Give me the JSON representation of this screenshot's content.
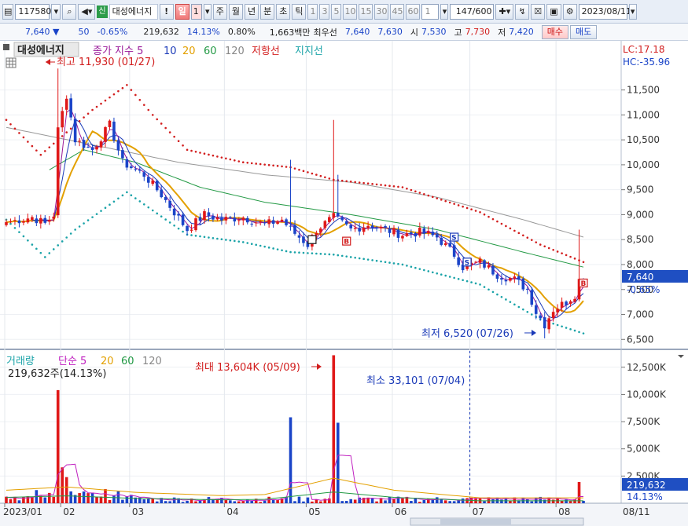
{
  "toolbar": {
    "code": "117580",
    "stock_name": "대성에너지",
    "badge": "신",
    "alert": "!",
    "period_selected": "일",
    "period_value": "1",
    "periods": [
      "주",
      "월",
      "년",
      "분",
      "초",
      "틱"
    ],
    "intervals": [
      "1",
      "3",
      "5",
      "10",
      "15",
      "30",
      "45",
      "60"
    ],
    "interval_value": "1",
    "count": "147",
    "total": "/600",
    "date": "2023/08/11"
  },
  "quote": {
    "price": "7,640",
    "change_arrow": "▼",
    "change": "50",
    "change_pct": "-0.65%",
    "volume": "219,632",
    "volume_ratio": "14.13%",
    "turnover": "0.80%",
    "amount": "1,663백만",
    "best_label": "최우선",
    "best_ask": "7,640",
    "best_bid": "7,630",
    "open_label": "시",
    "open": "7,530",
    "high_label": "고",
    "high": "7,730",
    "low_label": "저",
    "low": "7,420",
    "buy_label": "매수",
    "sell_label": "매도"
  },
  "price_panel": {
    "title": "대성에너지",
    "legend": [
      {
        "label": "종가 지수 5",
        "color": "#9a1a9a"
      },
      {
        "label": "10",
        "color": "#1a3ab8"
      },
      {
        "label": "20",
        "color": "#e3a000"
      },
      {
        "label": "60",
        "color": "#229944"
      },
      {
        "label": "120",
        "color": "#888888"
      },
      {
        "label": "저항선",
        "color": "#d21e1e"
      },
      {
        "label": "지지선",
        "color": "#1aa3a8"
      }
    ],
    "lc": "LC:17.18",
    "hc": "HC:-35.96",
    "max_annotation": "최고 11,930 (01/27)",
    "min_annotation": "최저 6,520 (07/26)",
    "price_tag": "7,640",
    "price_tag_pct": "-0.65%",
    "y_ticks": [
      "11,500",
      "11,000",
      "10,500",
      "10,000",
      "9,500",
      "9,000",
      "8,500",
      "8,000",
      "7,500",
      "7,000",
      "6,500"
    ]
  },
  "volume_panel": {
    "legend": [
      {
        "label": "거래량",
        "color": "#1aa3a8"
      },
      {
        "label": "단순 5",
        "color": "#c020c0"
      },
      {
        "label": "20",
        "color": "#e3a000"
      },
      {
        "label": "60",
        "color": "#229944"
      },
      {
        "label": "120",
        "color": "#888888"
      }
    ],
    "summary": "219,632주(14.13%)",
    "max_annotation": "최대 13,604K (05/09)",
    "min_annotation": "최소 33,101 (07/04)",
    "volume_tag": "219,632",
    "volume_tag_pct": "14.13%",
    "y_ticks": [
      "12,500K",
      "10,000K",
      "7,500K",
      "5,000K",
      "2,500K"
    ]
  },
  "x_axis": {
    "labels": [
      "2023/01",
      "02",
      "03",
      "04",
      "05",
      "06",
      "07",
      "08"
    ],
    "end_label": "08/11"
  },
  "chart_data": {
    "type": "candlestick",
    "price_range": [
      6300,
      11950
    ],
    "volume_range": [
      0,
      14000000
    ],
    "anchors": [
      {
        "i": 0,
        "c": 8850
      },
      {
        "i": 6,
        "c": 8950
      },
      {
        "i": 9,
        "c": 8820
      },
      {
        "i": 11,
        "c": 9000
      },
      {
        "i": 12,
        "c": 10700
      },
      {
        "i": 14,
        "c": 11400
      },
      {
        "i": 16,
        "c": 10500
      },
      {
        "i": 20,
        "c": 10300
      },
      {
        "i": 24,
        "c": 10800
      },
      {
        "i": 27,
        "c": 10050
      },
      {
        "i": 32,
        "c": 9800
      },
      {
        "i": 36,
        "c": 9400
      },
      {
        "i": 42,
        "c": 8700
      },
      {
        "i": 46,
        "c": 9000
      },
      {
        "i": 50,
        "c": 8900
      },
      {
        "i": 55,
        "c": 8950
      },
      {
        "i": 60,
        "c": 8800
      },
      {
        "i": 64,
        "c": 8900
      },
      {
        "i": 66,
        "c": 8700
      },
      {
        "i": 70,
        "c": 8400
      },
      {
        "i": 72,
        "c": 8700
      },
      {
        "i": 76,
        "c": 8950
      },
      {
        "i": 80,
        "c": 8700
      },
      {
        "i": 84,
        "c": 8800
      },
      {
        "i": 88,
        "c": 8700
      },
      {
        "i": 92,
        "c": 8600
      },
      {
        "i": 96,
        "c": 8650
      },
      {
        "i": 100,
        "c": 8550
      },
      {
        "i": 104,
        "c": 8200
      },
      {
        "i": 106,
        "c": 7950
      },
      {
        "i": 110,
        "c": 8050
      },
      {
        "i": 114,
        "c": 7800
      },
      {
        "i": 118,
        "c": 7700
      },
      {
        "i": 121,
        "c": 7500
      },
      {
        "i": 123,
        "c": 7050
      },
      {
        "i": 125,
        "c": 6800
      },
      {
        "i": 127,
        "c": 7100
      },
      {
        "i": 130,
        "c": 7250
      },
      {
        "i": 132,
        "c": 7400
      },
      {
        "i": 133,
        "c": 7690
      },
      {
        "i": 134,
        "c": 7640
      }
    ],
    "spikes": [
      {
        "i": 12,
        "high": 11930,
        "vol": 10400000
      },
      {
        "i": 66,
        "high": 10100,
        "vol": 7900000
      },
      {
        "i": 76,
        "high": 10900,
        "vol": 13604000
      },
      {
        "i": 77,
        "high": 9800,
        "vol": 7400000
      },
      {
        "i": 133,
        "high": 8700,
        "vol": 1950000
      }
    ],
    "resistance": [
      {
        "i": 0,
        "p": 10900
      },
      {
        "i": 8,
        "p": 10200
      },
      {
        "i": 20,
        "p": 11100
      },
      {
        "i": 28,
        "p": 11600
      },
      {
        "i": 34,
        "p": 11000
      },
      {
        "i": 42,
        "p": 10300
      },
      {
        "i": 55,
        "p": 10050
      },
      {
        "i": 66,
        "p": 9950
      },
      {
        "i": 76,
        "p": 9700
      },
      {
        "i": 92,
        "p": 9550
      },
      {
        "i": 110,
        "p": 9050
      },
      {
        "i": 124,
        "p": 8400
      },
      {
        "i": 134,
        "p": 8050
      }
    ],
    "support": [
      {
        "i": 0,
        "p": 8900
      },
      {
        "i": 9,
        "p": 8150
      },
      {
        "i": 16,
        "p": 8700
      },
      {
        "i": 28,
        "p": 9450
      },
      {
        "i": 42,
        "p": 8600
      },
      {
        "i": 55,
        "p": 8450
      },
      {
        "i": 66,
        "p": 8250
      },
      {
        "i": 76,
        "p": 8200
      },
      {
        "i": 92,
        "p": 8000
      },
      {
        "i": 110,
        "p": 7600
      },
      {
        "i": 124,
        "p": 6900
      },
      {
        "i": 134,
        "p": 6620
      }
    ],
    "ma120": [
      {
        "i": 0,
        "p": 10750
      },
      {
        "i": 20,
        "p": 10400
      },
      {
        "i": 40,
        "p": 10050
      },
      {
        "i": 60,
        "p": 9800
      },
      {
        "i": 80,
        "p": 9650
      },
      {
        "i": 100,
        "p": 9350
      },
      {
        "i": 120,
        "p": 8900
      },
      {
        "i": 134,
        "p": 8550
      }
    ],
    "ma60": [
      {
        "i": 10,
        "p": 9900
      },
      {
        "i": 18,
        "p": 10300
      },
      {
        "i": 30,
        "p": 10050
      },
      {
        "i": 45,
        "p": 9550
      },
      {
        "i": 60,
        "p": 9250
      },
      {
        "i": 80,
        "p": 9000
      },
      {
        "i": 100,
        "p": 8700
      },
      {
        "i": 120,
        "p": 8250
      },
      {
        "i": 134,
        "p": 7950
      }
    ],
    "ma20_vol": [
      {
        "i": 0,
        "v": 1200000
      },
      {
        "i": 14,
        "v": 1500000
      },
      {
        "i": 30,
        "v": 1000000
      },
      {
        "i": 50,
        "v": 700000
      },
      {
        "i": 60,
        "v": 800000
      },
      {
        "i": 76,
        "v": 2300000
      },
      {
        "i": 90,
        "v": 1200000
      },
      {
        "i": 110,
        "v": 500000
      },
      {
        "i": 134,
        "v": 500000
      }
    ],
    "month_starts": [
      0,
      13,
      29,
      51,
      70,
      90,
      108,
      128
    ],
    "dotted_line_at": 108
  }
}
